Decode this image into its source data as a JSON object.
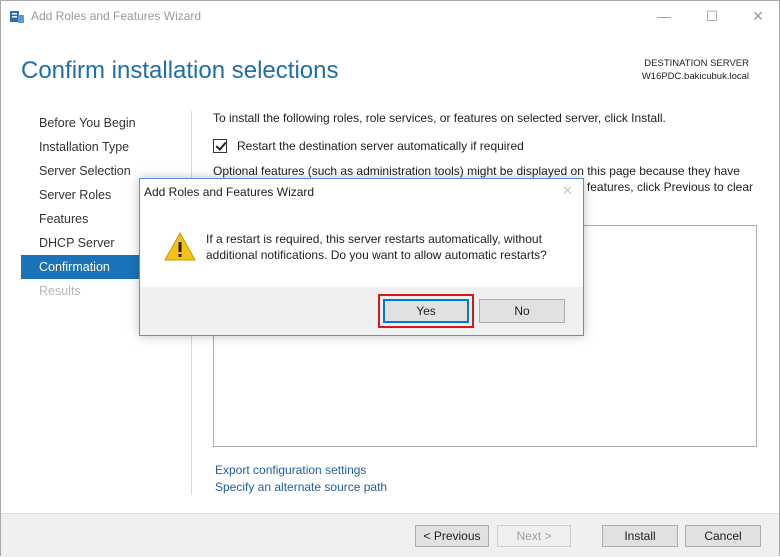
{
  "window": {
    "title": "Add Roles and Features Wizard",
    "minimize_glyph": "—",
    "maximize_glyph": "☐",
    "close_glyph": "✕"
  },
  "header": {
    "title": "Confirm installation selections",
    "destination_label": "DESTINATION SERVER",
    "destination_value": "W16PDC.bakicubuk.local"
  },
  "nav": {
    "items": [
      {
        "label": "Before You Begin",
        "state": "normal"
      },
      {
        "label": "Installation Type",
        "state": "normal"
      },
      {
        "label": "Server Selection",
        "state": "normal"
      },
      {
        "label": "Server Roles",
        "state": "normal"
      },
      {
        "label": "Features",
        "state": "normal"
      },
      {
        "label": "DHCP Server",
        "state": "normal"
      },
      {
        "label": "Confirmation",
        "state": "active"
      },
      {
        "label": "Results",
        "state": "disabled"
      }
    ]
  },
  "content": {
    "intro": "To install the following roles, role services, or features on selected server, click Install.",
    "restart_checkbox_label": "Restart the destination server automatically if required",
    "restart_checked": true,
    "optional_text": "Optional features (such as administration tools) might be displayed on this page because they have",
    "optional_text_2": "l features, click Previous to clear",
    "export_link": "Export configuration settings",
    "alternate_link": "Specify an alternate source path"
  },
  "footer": {
    "previous": "< Previous",
    "next": "Next >",
    "install": "Install",
    "cancel": "Cancel"
  },
  "dialog": {
    "title": "Add Roles and Features Wizard",
    "close_glyph": "✕",
    "message": "If a restart is required, this server restarts automatically, without additional notifications. Do you want to allow automatic restarts?",
    "icon": "warning-icon",
    "yes": "Yes",
    "no": "No"
  },
  "colors": {
    "accent": "#1a73b8",
    "title_blue": "#1f6ea8",
    "highlight_red": "#d11b1b"
  }
}
